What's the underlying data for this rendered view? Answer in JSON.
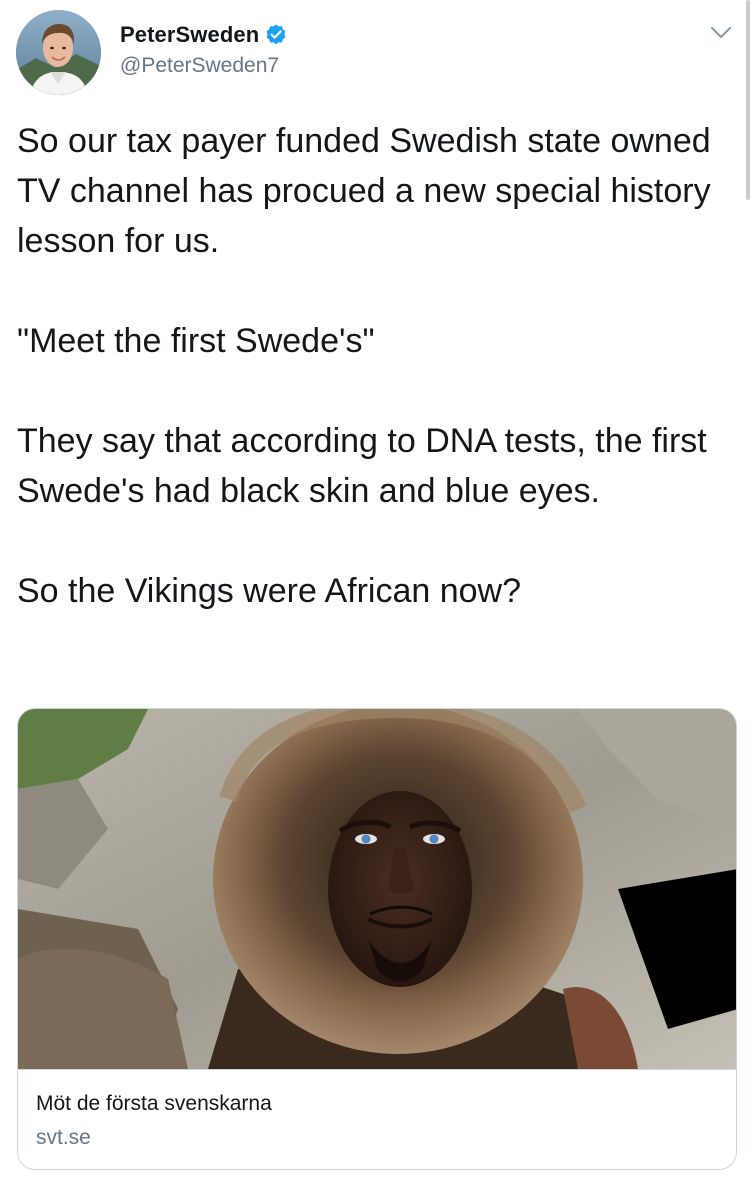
{
  "user": {
    "display_name": "PeterSweden",
    "handle": "@PeterSweden7",
    "verified": true,
    "avatar_icon": "profile-photo"
  },
  "tweet": {
    "paragraphs": [
      "So our tax payer funded Swedish state owned TV channel has procued a new special history lesson for us.",
      "\"Meet the first Swede's\"",
      "They say that according to DNA tests, the first Swede's had black skin and blue eyes.",
      "So the Vikings were African now?"
    ]
  },
  "card": {
    "title": "Möt de första svenskarna",
    "domain": "svt.se"
  },
  "colors": {
    "verified_badge": "#1da1f2",
    "secondary_text": "#657786",
    "border": "#ccd6dd"
  }
}
